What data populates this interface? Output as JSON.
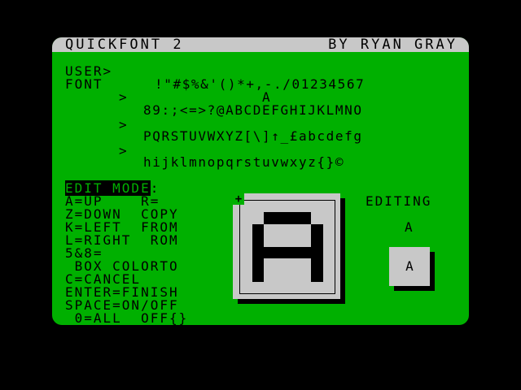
{
  "title": {
    "left": "QUICKFONT 2",
    "right": "BY RYAN GRAY"
  },
  "font_panel": {
    "user_label": "USER>",
    "font_label": "FONT",
    "row1": "!\"#$%&'()*+,-./01234567",
    "current_char": "A",
    "arrows": [
      ">",
      ">",
      ">"
    ],
    "row2": "89:;<=>?@ABCDEFGHIJKLMNO",
    "row3": "PQRSTUVWXYZ[\\]↑_£abcdefg",
    "row4": "hijklmnopqrstuvwxyz{}©"
  },
  "help": {
    "edit_mode": "EDIT MODE",
    "edit_mode_colon": ":",
    "lines": [
      "A=UP    R=",
      "Z=DOWN  COPY",
      "K=LEFT  FROM",
      "L=RIGHT  ROM",
      "5&8=",
      " BOX COLORTO",
      "C=CANCEL",
      "ENTER=FINISH",
      "SPACE=ON/OFF",
      " 0=ALL  OFF{}"
    ]
  },
  "editor": {
    "cursor_symbol": "+",
    "pixels": [
      [
        0,
        0,
        0,
        0,
        0,
        0,
        0,
        0
      ],
      [
        0,
        0,
        1,
        1,
        1,
        1,
        0,
        0
      ],
      [
        0,
        1,
        0,
        0,
        0,
        0,
        1,
        0
      ],
      [
        0,
        1,
        0,
        0,
        0,
        0,
        1,
        0
      ],
      [
        0,
        1,
        1,
        1,
        1,
        1,
        1,
        0
      ],
      [
        0,
        1,
        0,
        0,
        0,
        0,
        1,
        0
      ],
      [
        0,
        1,
        0,
        0,
        0,
        0,
        1,
        0
      ],
      [
        0,
        0,
        0,
        0,
        0,
        0,
        0,
        0
      ]
    ]
  },
  "status": {
    "editing_label": "EDITING",
    "editing_char": "A",
    "preview_char": "A"
  }
}
